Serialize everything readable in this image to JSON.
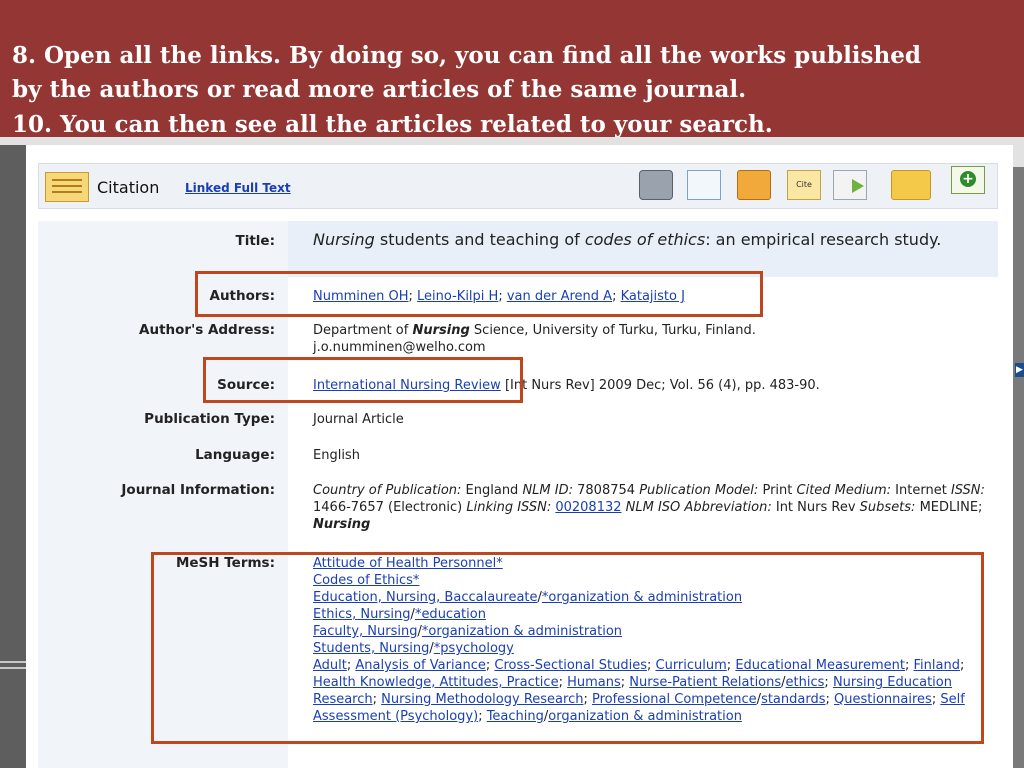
{
  "banner": {
    "line1": "8. Open all the links. By doing so, you can find all the works published",
    "line2": "by the authors or read more articles of the same journal.",
    "line3": "10. You can then see all the articles related to your search."
  },
  "toolbar": {
    "citation_label": "Citation",
    "linked_full_text": "Linked Full Text",
    "tools": [
      "printer-icon",
      "email-icon",
      "save-icon",
      "cite-icon",
      "export-icon",
      "folder-icon",
      "add-to-folder-icon"
    ],
    "cite_text": "Cite"
  },
  "record": {
    "title_label": "Title:",
    "title_word1": "Nursing",
    "title_mid": " students and teaching of ",
    "title_word2": "codes of ethics",
    "title_end": ": an empirical research study.",
    "authors_label": "Authors:",
    "authors": [
      "Numminen OH",
      "Leino-Kilpi H",
      "van der Arend A",
      "Katajisto J"
    ],
    "address_label": "Author's Address:",
    "address_pre": "Department of ",
    "address_em": "Nursing",
    "address_post": " Science, University of Turku, Turku, Finland.",
    "address_email": "j.o.numminen@welho.com",
    "source_label": "Source:",
    "source_link": "International Nursing Review",
    "source_rest": " [Int Nurs Rev] 2009 Dec; Vol. 56 (4), pp. 483-90.",
    "pubtype_label": "Publication Type:",
    "pubtype_value": "Journal Article",
    "language_label": "Language:",
    "language_value": "English",
    "journal_label": "Journal Information:",
    "journal": {
      "country_label": "Country of Publication:",
      "country": "England",
      "nlm_label": "NLM ID:",
      "nlm": "7808754",
      "model_label": "Publication Model:",
      "model": "Print",
      "medium_label": "Cited Medium:",
      "medium": "Internet",
      "issn_label": "ISSN:",
      "issn": "1466-7657 (Electronic)",
      "linking_label": "Linking ISSN:",
      "linking": "00208132",
      "abbr_label": "NLM ISO Abbreviation:",
      "abbr": "Int Nurs Rev",
      "subsets_label": "Subsets:",
      "subsets": "MEDLINE;",
      "subsets_em": "Nursing"
    },
    "mesh_label": "MeSH Terms:",
    "mesh": {
      "t1": "Attitude of Health Personnel*",
      "t2": "Codes of Ethics*",
      "t3a": "Education, Nursing, Baccalaureate",
      "t3b": "*organization & administration",
      "t4a": "Ethics, Nursing",
      "t4b": "*education",
      "t5a": "Faculty, Nursing",
      "t5b": "*organization & administration",
      "t6a": "Students, Nursing",
      "t6b": "*psychology",
      "t7": "Adult",
      "t8": "Analysis of Variance",
      "t9": "Cross-Sectional Studies",
      "t10": "Curriculum",
      "t11": "Educational Measurement",
      "t12": "Finland",
      "t13": "Health Knowledge, Attitudes, Practice",
      "t14": "Humans",
      "t15a": "Nurse-Patient Relations",
      "t15b": "ethics",
      "t16": "Nursing Education Research",
      "t17": "Nursing Methodology Research",
      "t18a": "Professional Competence",
      "t18b": "standards",
      "t19": "Questionnaires",
      "t20": "Self Assessment (Psychology)",
      "t21a": "Teaching",
      "t21b": "organization & administration"
    }
  }
}
